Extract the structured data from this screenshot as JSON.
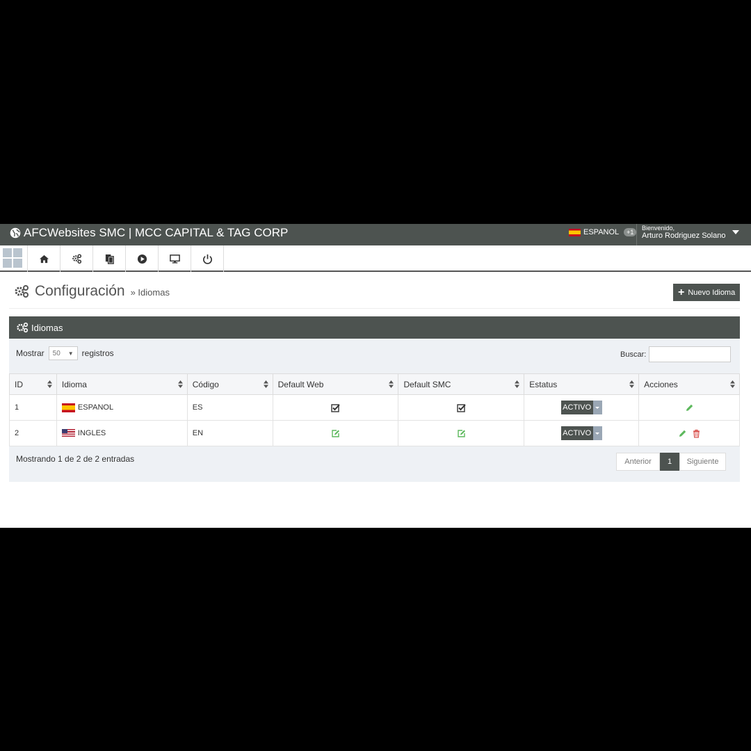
{
  "header": {
    "brand": "AFCWebsites SMC | MCC CAPITAL & TAG CORP",
    "language": "ESPANOL",
    "language_badge": "+1",
    "welcome": "Bienvenido,",
    "user_name": "Arturo Rodriguez Solano"
  },
  "toolbar": {
    "icons": [
      "home-icon",
      "cogs-icon",
      "copy-icon",
      "play-icon",
      "monitor-icon",
      "power-icon"
    ]
  },
  "page": {
    "title": "Configuración",
    "breadcrumb": "» Idiomas",
    "new_button": "Nuevo Idioma"
  },
  "panel": {
    "title": "Idiomas",
    "show_label": "Mostrar",
    "show_value": "50",
    "show_suffix": "registros",
    "search_label": "Buscar:",
    "search_value": "",
    "columns": [
      "ID",
      "Idioma",
      "Código",
      "Default Web",
      "Default SMC",
      "Estatus",
      "Acciones"
    ],
    "rows": [
      {
        "id": "1",
        "language": "ESPANOL",
        "flag": "es",
        "code": "ES",
        "default_web": true,
        "default_smc": true,
        "status": "ACTIVO",
        "can_delete": false
      },
      {
        "id": "2",
        "language": "INGLES",
        "flag": "us",
        "code": "EN",
        "default_web": false,
        "default_smc": false,
        "status": "ACTIVO",
        "can_delete": true
      }
    ],
    "info": "Mostrando 1 de 2 de 2 entradas",
    "pagination": {
      "prev": "Anterior",
      "current": "1",
      "next": "Siguiente"
    }
  },
  "colors": {
    "dark": "#4d5350",
    "panel_bg": "#eef1f5",
    "edit_green": "#5cb85c",
    "delete_red": "#d9534f"
  }
}
